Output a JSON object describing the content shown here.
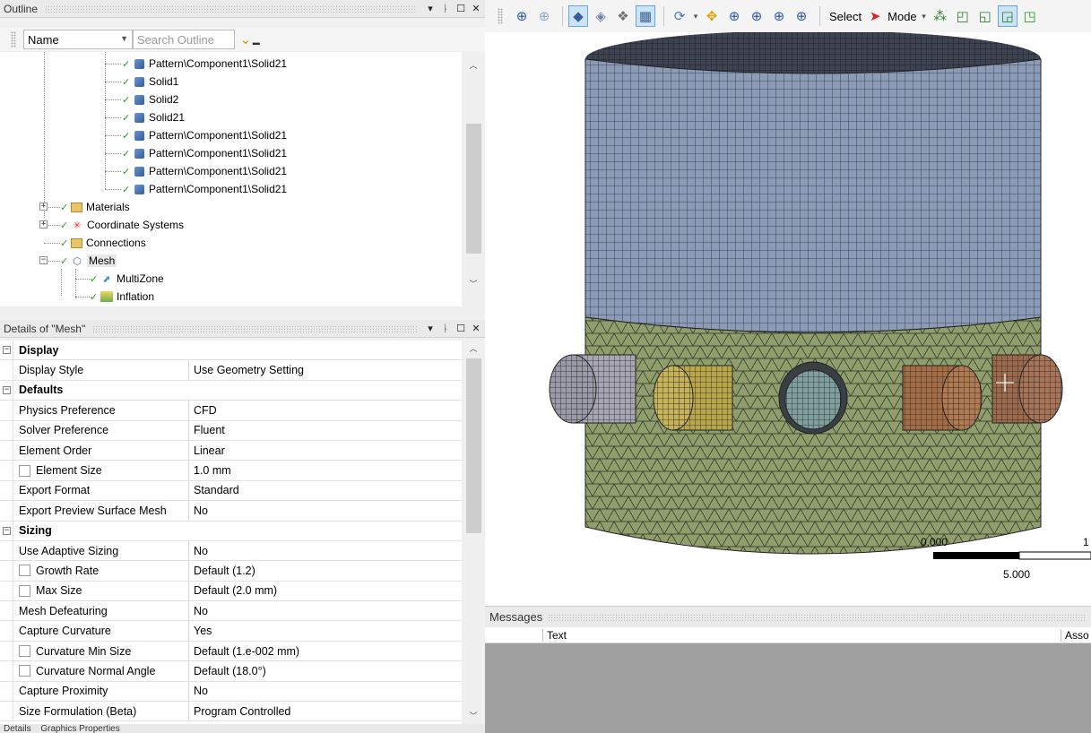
{
  "outline": {
    "title": "Outline",
    "filter_select": "Name",
    "search_placeholder": "Search Outline",
    "tree": [
      {
        "label": "Pattern\\Component1\\Solid21"
      },
      {
        "label": "Solid1"
      },
      {
        "label": "Solid2"
      },
      {
        "label": "Solid21"
      },
      {
        "label": "Pattern\\Component1\\Solid21"
      },
      {
        "label": "Pattern\\Component1\\Solid21"
      },
      {
        "label": "Pattern\\Component1\\Solid21"
      },
      {
        "label": "Pattern\\Component1\\Solid21"
      },
      {
        "label": "Materials"
      },
      {
        "label": "Coordinate Systems"
      },
      {
        "label": "Connections"
      },
      {
        "label": "Mesh"
      },
      {
        "label": "MultiZone"
      },
      {
        "label": "Inflation"
      }
    ]
  },
  "details": {
    "title": "Details of \"Mesh\"",
    "rows": [
      {
        "type": "section",
        "label": "Display"
      },
      {
        "type": "prop",
        "label": "Display Style",
        "value": "Use Geometry Setting"
      },
      {
        "type": "section",
        "label": "Defaults"
      },
      {
        "type": "prop",
        "label": "Physics Preference",
        "value": "CFD"
      },
      {
        "type": "prop",
        "label": "Solver Preference",
        "value": "Fluent"
      },
      {
        "type": "prop",
        "label": "Element Order",
        "value": "Linear"
      },
      {
        "type": "check",
        "label": "Element Size",
        "value": "1.0 mm"
      },
      {
        "type": "prop",
        "label": "Export Format",
        "value": "Standard"
      },
      {
        "type": "prop",
        "label": "Export Preview Surface Mesh",
        "value": "No"
      },
      {
        "type": "section",
        "label": "Sizing"
      },
      {
        "type": "prop",
        "label": "Use Adaptive Sizing",
        "value": "No"
      },
      {
        "type": "check",
        "label": "Growth Rate",
        "value": "Default (1.2)"
      },
      {
        "type": "check",
        "label": "Max Size",
        "value": "Default (2.0 mm)"
      },
      {
        "type": "prop",
        "label": "Mesh Defeaturing",
        "value": "No"
      },
      {
        "type": "prop",
        "label": "Capture Curvature",
        "value": "Yes"
      },
      {
        "type": "check",
        "label": "Curvature Min Size",
        "value": "Default (1.e-002 mm)"
      },
      {
        "type": "check",
        "label": "Curvature Normal Angle",
        "value": "Default (18.0°)"
      },
      {
        "type": "prop",
        "label": "Capture Proximity",
        "value": "No"
      },
      {
        "type": "prop",
        "label": "Size Formulation (Beta)",
        "value": "Program Controlled"
      }
    ]
  },
  "bottom_tabs": [
    "Details",
    "Graphics Properties"
  ],
  "toolbar": {
    "select_label": "Select",
    "mode_label": "Mode"
  },
  "viewport": {
    "scale_left": "0.000",
    "scale_mid": "5.000",
    "scale_right": "1",
    "colors": {
      "cylinder_top": "#8a9ab8",
      "cylinder_bottom": "#8f9e6c",
      "mesh_line": "#2a2f36"
    }
  },
  "messages": {
    "title": "Messages",
    "col_text": "Text",
    "col_assoc": "Asso"
  }
}
